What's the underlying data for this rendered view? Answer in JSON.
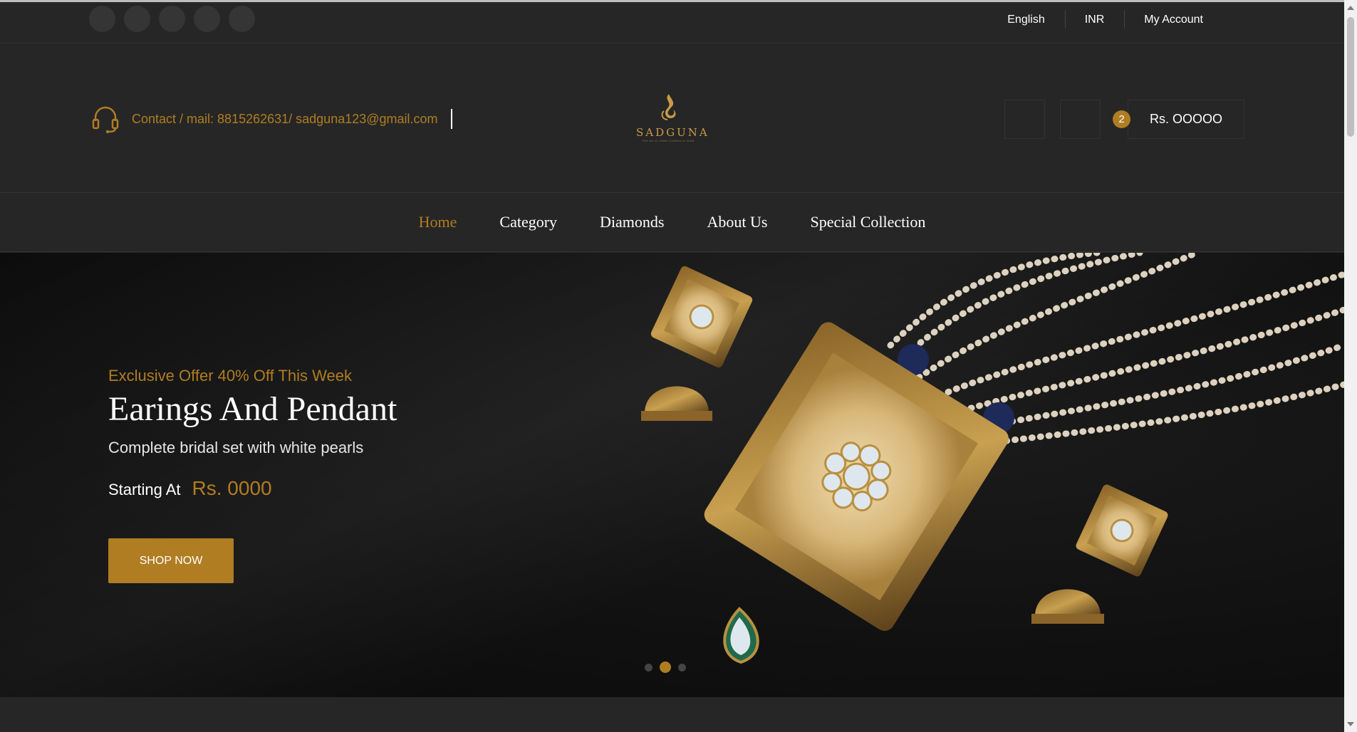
{
  "topbar": {
    "language": "English",
    "currency": "INR",
    "account": "My Account"
  },
  "header": {
    "contact_text": "Contact / mail: 8815262631/ sadguna123@gmail.com",
    "logo_name": "SADGUNA",
    "logo_tagline": "The Art of Jewel Crafted in India",
    "cart_count": "2",
    "cart_total": "Rs. OOOOO"
  },
  "nav": {
    "items": [
      "Home",
      "Category",
      "Diamonds",
      "About Us",
      "Special Collection"
    ],
    "active": "Home"
  },
  "hero": {
    "offer": "Exclusive Offer 40% Off This Week",
    "title": "Earings And Pendant",
    "subtitle": "Complete bridal set with white pearls",
    "price_label": "Starting At",
    "price_value": "Rs. 0000",
    "cta": "SHOP NOW",
    "slide_count": 3,
    "active_slide": 2
  },
  "colors": {
    "accent": "#b07d22",
    "background": "#262626",
    "hero_bg": "#111111"
  }
}
